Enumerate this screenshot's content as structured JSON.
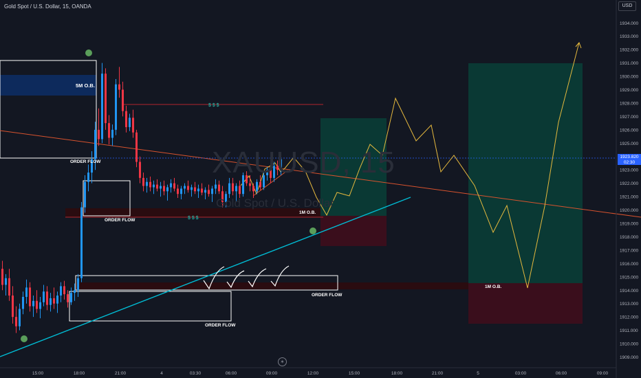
{
  "header": {
    "title": "Gold Spot / U.S. Dollar, 15, OANDA",
    "currency": "USD"
  },
  "watermark": {
    "symbol": "XAUUSD, 15",
    "name": "Gold Spot / U.S. Dollar"
  },
  "current_price": {
    "price": "1923.820",
    "countdown": "02:30"
  },
  "colors": {
    "background": "#131722",
    "up": "#2196f3",
    "down": "#f23645",
    "trendline": "#00bcd4",
    "projection": "#e6b93e",
    "ob_blue": "#0d2a5c",
    "ob_red": "#3b0d12",
    "ob_red_faint": "#2a0c10",
    "long_green": "#0a3d36",
    "long_red": "#3a0e1c",
    "pivot_green": "#5a9e5a",
    "liquidity": "#26a69a"
  },
  "chart_data": {
    "type": "candlestick",
    "symbol": "XAUUSD",
    "timeframe": "15",
    "ylim": [
      1908.5,
      1935.5
    ],
    "yticks": [
      "1909.000",
      "1910.000",
      "1911.000",
      "1912.000",
      "1913.000",
      "1914.000",
      "1915.000",
      "1916.000",
      "1917.000",
      "1918.000",
      "1919.000",
      "1920.000",
      "1921.000",
      "1922.000",
      "1923.000",
      "1924.000",
      "1925.000",
      "1926.000",
      "1927.000",
      "1928.000",
      "1929.000",
      "1930.000",
      "1931.000",
      "1932.000",
      "1933.000",
      "1934.000"
    ],
    "xticks": [
      "15:00",
      "18:00",
      "21:00",
      "4",
      "03:30",
      "06:00",
      "09:00",
      "12:00",
      "15:00",
      "18:00",
      "21:00",
      "5",
      "03:00",
      "06:00",
      "09:00"
    ],
    "candles": [
      {
        "o": 1915.6,
        "h": 1916.2,
        "l": 1914.0,
        "c": 1914.4
      },
      {
        "o": 1914.4,
        "h": 1915.2,
        "l": 1913.6,
        "c": 1914.9
      },
      {
        "o": 1914.9,
        "h": 1915.6,
        "l": 1913.2,
        "c": 1913.6
      },
      {
        "o": 1913.6,
        "h": 1914.3,
        "l": 1911.5,
        "c": 1912.0
      },
      {
        "o": 1912.0,
        "h": 1912.8,
        "l": 1910.8,
        "c": 1911.3
      },
      {
        "o": 1911.3,
        "h": 1913.0,
        "l": 1911.0,
        "c": 1912.6
      },
      {
        "o": 1912.6,
        "h": 1913.9,
        "l": 1912.2,
        "c": 1913.5
      },
      {
        "o": 1913.5,
        "h": 1914.8,
        "l": 1913.0,
        "c": 1914.2
      },
      {
        "o": 1914.2,
        "h": 1914.6,
        "l": 1912.4,
        "c": 1912.8
      },
      {
        "o": 1912.8,
        "h": 1913.6,
        "l": 1912.0,
        "c": 1913.2
      },
      {
        "o": 1913.2,
        "h": 1914.0,
        "l": 1912.3,
        "c": 1912.6
      },
      {
        "o": 1912.6,
        "h": 1913.5,
        "l": 1911.9,
        "c": 1913.1
      },
      {
        "o": 1913.1,
        "h": 1914.4,
        "l": 1912.8,
        "c": 1913.9
      },
      {
        "o": 1913.9,
        "h": 1914.3,
        "l": 1912.5,
        "c": 1912.9
      },
      {
        "o": 1912.9,
        "h": 1913.8,
        "l": 1912.4,
        "c": 1913.4
      },
      {
        "o": 1913.4,
        "h": 1914.2,
        "l": 1912.6,
        "c": 1913.0
      },
      {
        "o": 1913.0,
        "h": 1913.9,
        "l": 1912.3,
        "c": 1913.6
      },
      {
        "o": 1913.6,
        "h": 1914.6,
        "l": 1913.1,
        "c": 1914.3
      },
      {
        "o": 1914.3,
        "h": 1914.7,
        "l": 1913.3,
        "c": 1913.7
      },
      {
        "o": 1913.7,
        "h": 1914.0,
        "l": 1912.7,
        "c": 1913.1
      },
      {
        "o": 1913.1,
        "h": 1914.2,
        "l": 1912.9,
        "c": 1913.8
      },
      {
        "o": 1913.8,
        "h": 1914.5,
        "l": 1913.2,
        "c": 1914.0
      },
      {
        "o": 1914.0,
        "h": 1915.2,
        "l": 1913.5,
        "c": 1914.9
      },
      {
        "o": 1914.9,
        "h": 1920.6,
        "l": 1914.6,
        "c": 1920.2
      },
      {
        "o": 1920.2,
        "h": 1922.6,
        "l": 1919.8,
        "c": 1922.1
      },
      {
        "o": 1922.1,
        "h": 1923.4,
        "l": 1921.4,
        "c": 1922.8
      },
      {
        "o": 1922.8,
        "h": 1924.4,
        "l": 1922.0,
        "c": 1923.8
      },
      {
        "o": 1923.8,
        "h": 1926.6,
        "l": 1923.0,
        "c": 1926.0
      },
      {
        "o": 1926.0,
        "h": 1927.6,
        "l": 1924.8,
        "c": 1925.3
      },
      {
        "o": 1925.3,
        "h": 1931.0,
        "l": 1925.0,
        "c": 1930.2
      },
      {
        "o": 1930.2,
        "h": 1930.6,
        "l": 1926.0,
        "c": 1926.5
      },
      {
        "o": 1926.5,
        "h": 1927.1,
        "l": 1924.9,
        "c": 1925.4
      },
      {
        "o": 1925.4,
        "h": 1926.4,
        "l": 1924.8,
        "c": 1926.0
      },
      {
        "o": 1926.0,
        "h": 1929.8,
        "l": 1925.6,
        "c": 1929.4
      },
      {
        "o": 1929.4,
        "h": 1930.7,
        "l": 1928.4,
        "c": 1929.0
      },
      {
        "o": 1929.0,
        "h": 1929.6,
        "l": 1927.0,
        "c": 1927.4
      },
      {
        "o": 1927.4,
        "h": 1927.8,
        "l": 1925.8,
        "c": 1926.2
      },
      {
        "o": 1926.2,
        "h": 1927.2,
        "l": 1925.9,
        "c": 1926.9
      },
      {
        "o": 1926.9,
        "h": 1927.5,
        "l": 1925.4,
        "c": 1925.8
      },
      {
        "o": 1925.8,
        "h": 1926.0,
        "l": 1923.2,
        "c": 1923.6
      },
      {
        "o": 1923.6,
        "h": 1924.0,
        "l": 1922.0,
        "c": 1922.4
      },
      {
        "o": 1922.4,
        "h": 1922.8,
        "l": 1921.4,
        "c": 1921.8
      },
      {
        "o": 1921.8,
        "h": 1922.4,
        "l": 1921.3,
        "c": 1922.1
      },
      {
        "o": 1922.1,
        "h": 1922.5,
        "l": 1921.4,
        "c": 1921.7
      },
      {
        "o": 1921.7,
        "h": 1922.2,
        "l": 1921.2,
        "c": 1921.9
      },
      {
        "o": 1921.9,
        "h": 1922.3,
        "l": 1921.4,
        "c": 1921.6
      },
      {
        "o": 1921.6,
        "h": 1922.1,
        "l": 1921.0,
        "c": 1921.8
      },
      {
        "o": 1921.8,
        "h": 1922.2,
        "l": 1921.1,
        "c": 1921.4
      },
      {
        "o": 1921.4,
        "h": 1921.9,
        "l": 1920.7,
        "c": 1921.7
      },
      {
        "o": 1921.7,
        "h": 1922.3,
        "l": 1921.3,
        "c": 1922.0
      },
      {
        "o": 1922.0,
        "h": 1922.4,
        "l": 1921.4,
        "c": 1921.6
      },
      {
        "o": 1921.6,
        "h": 1921.9,
        "l": 1920.9,
        "c": 1921.2
      },
      {
        "o": 1921.2,
        "h": 1921.8,
        "l": 1920.8,
        "c": 1921.6
      },
      {
        "o": 1921.6,
        "h": 1922.0,
        "l": 1921.2,
        "c": 1921.8
      },
      {
        "o": 1921.8,
        "h": 1922.2,
        "l": 1921.3,
        "c": 1921.5
      },
      {
        "o": 1921.5,
        "h": 1921.9,
        "l": 1921.0,
        "c": 1921.7
      },
      {
        "o": 1921.7,
        "h": 1922.1,
        "l": 1921.2,
        "c": 1921.4
      },
      {
        "o": 1921.4,
        "h": 1921.9,
        "l": 1920.9,
        "c": 1921.6
      },
      {
        "o": 1921.6,
        "h": 1922.0,
        "l": 1921.1,
        "c": 1921.3
      },
      {
        "o": 1921.3,
        "h": 1921.7,
        "l": 1920.8,
        "c": 1921.5
      },
      {
        "o": 1921.5,
        "h": 1921.9,
        "l": 1921.0,
        "c": 1921.2
      },
      {
        "o": 1921.2,
        "h": 1921.8,
        "l": 1920.6,
        "c": 1921.6
      },
      {
        "o": 1921.6,
        "h": 1922.3,
        "l": 1921.2,
        "c": 1921.9
      },
      {
        "o": 1921.9,
        "h": 1922.2,
        "l": 1921.2,
        "c": 1921.4
      },
      {
        "o": 1921.4,
        "h": 1921.8,
        "l": 1920.2,
        "c": 1920.6
      },
      {
        "o": 1920.6,
        "h": 1921.4,
        "l": 1920.2,
        "c": 1921.2
      },
      {
        "o": 1921.2,
        "h": 1922.4,
        "l": 1920.9,
        "c": 1922.0
      },
      {
        "o": 1922.0,
        "h": 1922.4,
        "l": 1921.1,
        "c": 1921.4
      },
      {
        "o": 1921.4,
        "h": 1922.0,
        "l": 1920.6,
        "c": 1921.8
      },
      {
        "o": 1921.8,
        "h": 1922.2,
        "l": 1920.9,
        "c": 1921.2
      },
      {
        "o": 1921.2,
        "h": 1922.8,
        "l": 1921.0,
        "c": 1922.6
      },
      {
        "o": 1922.6,
        "h": 1922.9,
        "l": 1921.8,
        "c": 1922.0
      },
      {
        "o": 1922.0,
        "h": 1922.6,
        "l": 1921.4,
        "c": 1921.8
      },
      {
        "o": 1921.8,
        "h": 1922.0,
        "l": 1920.9,
        "c": 1921.4
      },
      {
        "o": 1921.4,
        "h": 1922.3,
        "l": 1921.2,
        "c": 1922.1
      },
      {
        "o": 1922.1,
        "h": 1922.6,
        "l": 1921.5,
        "c": 1921.7
      },
      {
        "o": 1921.7,
        "h": 1922.9,
        "l": 1921.5,
        "c": 1922.6
      },
      {
        "o": 1922.6,
        "h": 1923.2,
        "l": 1922.2,
        "c": 1923.0
      },
      {
        "o": 1923.0,
        "h": 1923.5,
        "l": 1922.0,
        "c": 1922.4
      },
      {
        "o": 1922.4,
        "h": 1923.6,
        "l": 1922.1,
        "c": 1923.3
      },
      {
        "o": 1923.3,
        "h": 1923.7,
        "l": 1922.6,
        "c": 1923.0
      },
      {
        "o": 1923.0,
        "h": 1923.9,
        "l": 1922.6,
        "c": 1923.8
      }
    ]
  },
  "annotations": {
    "ob_5m": "5M O.B.",
    "order_flow_1": "ORDER FLOW",
    "order_flow_2": "ORDER FLOW",
    "order_flow_3": "ORDER FLOW",
    "order_flow_4": "ORDER FLOW",
    "ob_1m_a": "1M O.B.",
    "ob_1m_b": "1M O.B.",
    "liq_top": "$   $   $",
    "liq_mid": "$   $   $"
  }
}
